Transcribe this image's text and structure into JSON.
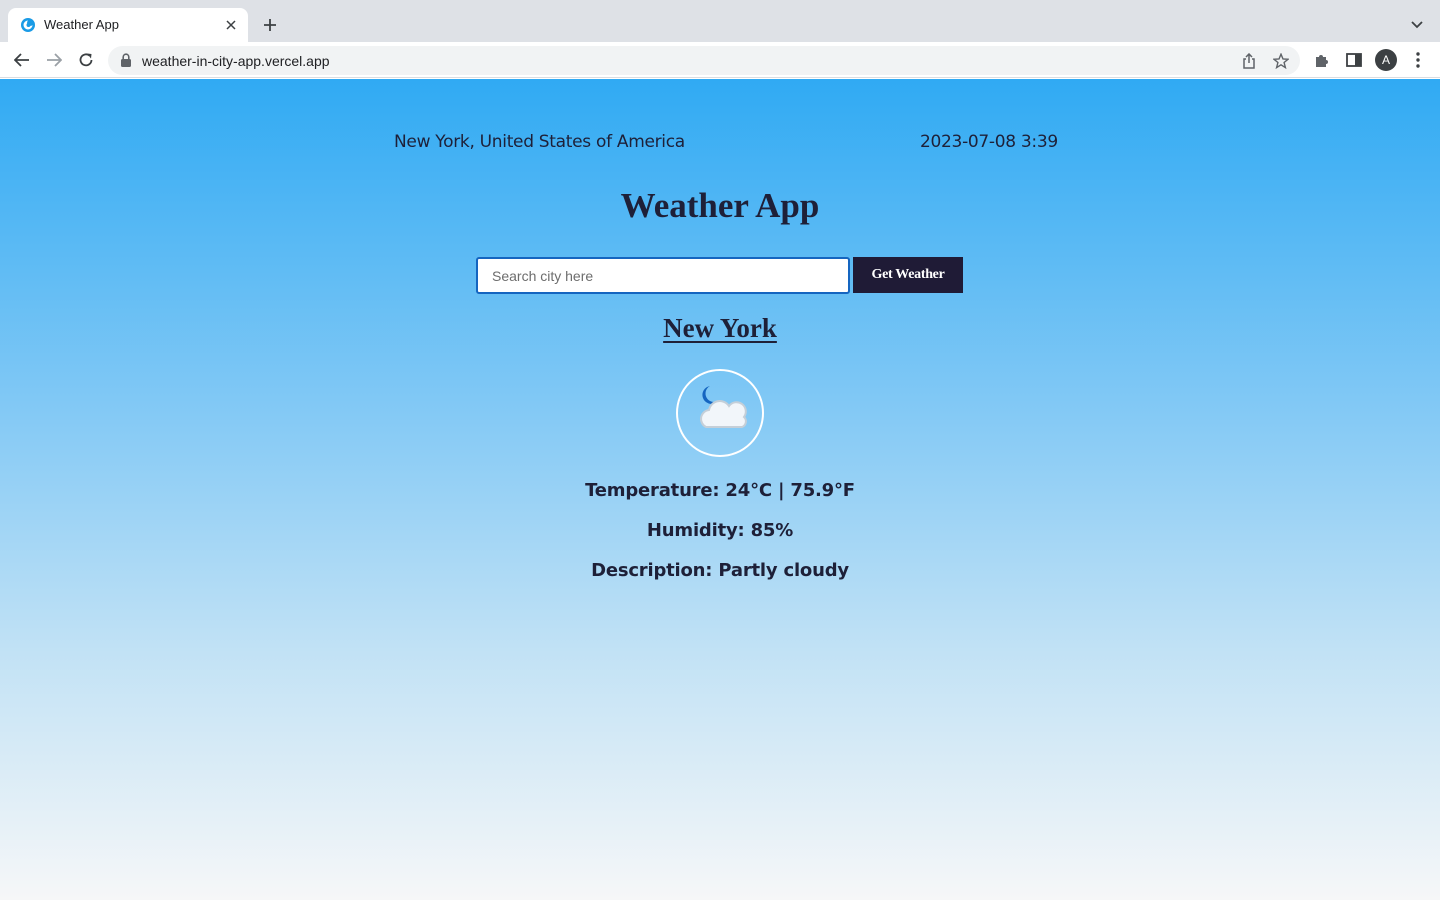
{
  "browser": {
    "tab_title": "Weather App",
    "url": "weather-in-city-app.vercel.app",
    "profile_initial": "A",
    "icons": [
      "weather-favicon",
      "close-icon",
      "plus-icon",
      "chevron-down-icon",
      "back-arrow-icon",
      "forward-arrow-icon",
      "reload-icon",
      "lock-icon",
      "share-icon",
      "star-icon",
      "puzzle-icon",
      "side-panel-icon",
      "more-vert-icon"
    ]
  },
  "header": {
    "location": "New York, United States of America",
    "datetime": "2023-07-08 3:39"
  },
  "app": {
    "title": "Weather App",
    "search_placeholder": "Search city here",
    "search_value": "",
    "button_label": "Get Weather",
    "accent_color": "#1f1b36",
    "input_border_color": "#1565c0"
  },
  "result": {
    "city": "New York",
    "icon": "moon-cloud-icon",
    "temperature": "Temperature: 24°C | 75.9°F",
    "humidity": "Humidity: 85%",
    "description": "Description: Partly cloudy"
  }
}
